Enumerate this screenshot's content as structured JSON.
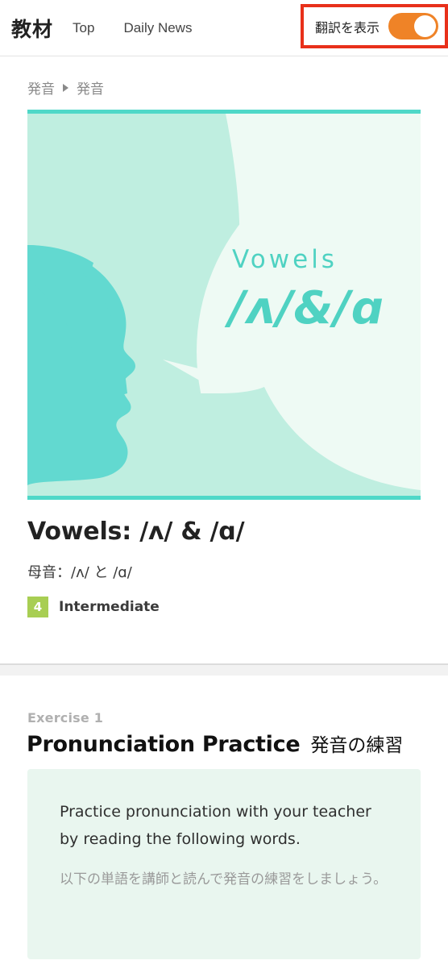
{
  "header": {
    "brand": "教材",
    "nav": [
      {
        "label": "Top",
        "name": "nav-top"
      },
      {
        "label": "Daily News",
        "name": "nav-daily-news"
      }
    ],
    "translation_toggle": {
      "label": "翻訳を表示",
      "state": "on",
      "accent_color": "#ef8327",
      "highlight_color": "#e8301a"
    }
  },
  "breadcrumb": {
    "items": [
      "発音",
      "発音"
    ],
    "separator": "▶"
  },
  "hero": {
    "overline": "Vowels",
    "headline": "/ʌ/ & /ɑ",
    "colors": {
      "border": "#4fd8c8",
      "face": "#62d9d0",
      "mid": "#b5ecdf",
      "bubble": "#eefaf4",
      "text": "#4fd2c2"
    }
  },
  "lesson": {
    "title": "Vowels: /ʌ/ & /ɑ/",
    "subtitle": "母音：/ʌ/ と /ɑ/",
    "level_number": "4",
    "level_name": "Intermediate",
    "level_color": "#a8ce53"
  },
  "exercise": {
    "label": "Exercise 1",
    "title_en": "Pronunciation Practice",
    "title_ja": "発音の練習",
    "instruction_en": "Practice pronunciation with your teacher by reading the following words.",
    "instruction_ja": "以下の単語を講師と読んで発音の練習をしましょう。"
  }
}
